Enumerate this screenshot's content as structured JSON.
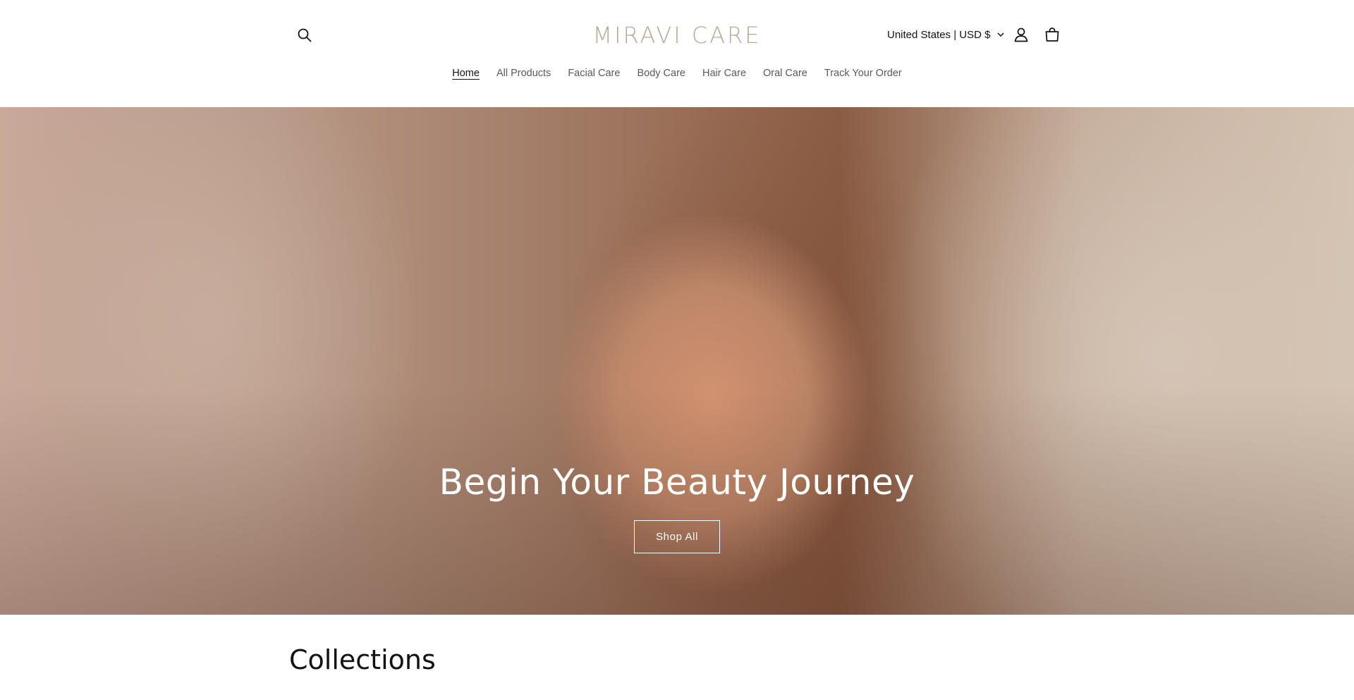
{
  "header": {
    "logo": "MIRAVI CARE",
    "localization": "United States | USD $",
    "icons": {
      "search": "search-icon",
      "account": "account-icon",
      "cart": "cart-icon",
      "chevron": "chevron-down-icon"
    }
  },
  "nav": {
    "items": [
      {
        "label": "Home",
        "active": true
      },
      {
        "label": "All Products"
      },
      {
        "label": "Facial Care"
      },
      {
        "label": "Body Care"
      },
      {
        "label": "Hair Care"
      },
      {
        "label": "Oral Care"
      },
      {
        "label": "Track Your Order"
      }
    ]
  },
  "hero": {
    "title": "Begin Your Beauty Journey",
    "button": "Shop All"
  },
  "collections": {
    "title": "Collections"
  },
  "colors": {
    "logo": "#b8a996",
    "text": "#121212",
    "nav_text": "#5a5a5a"
  }
}
